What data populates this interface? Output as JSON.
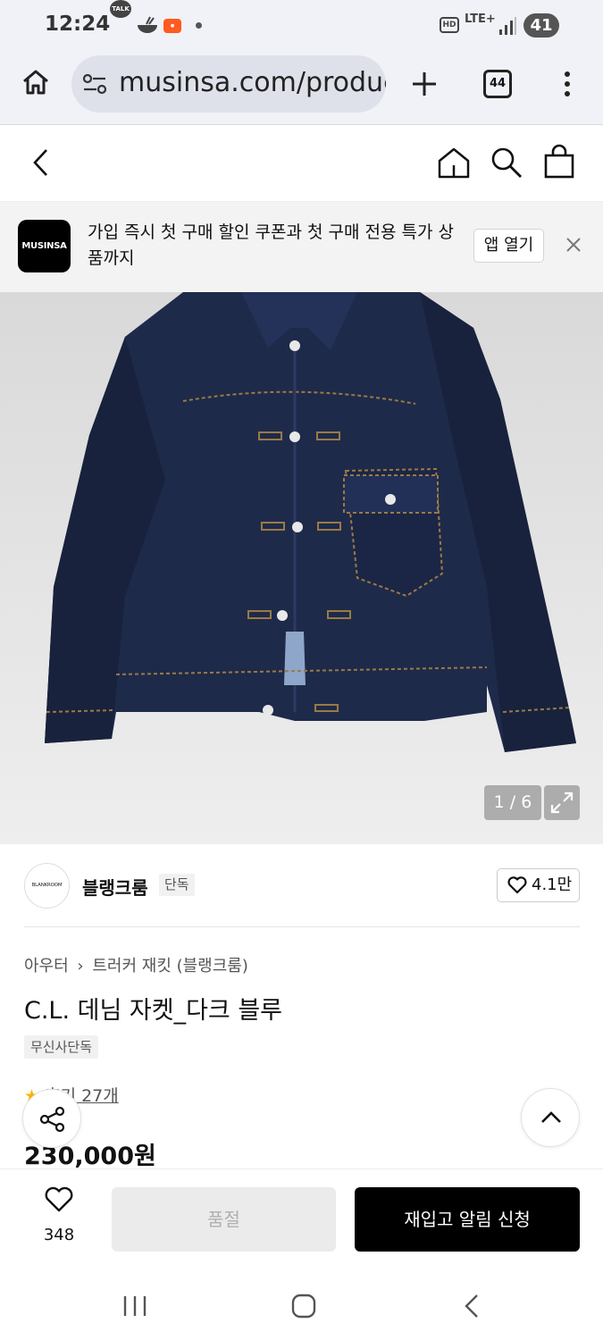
{
  "status_bar": {
    "time": "12:24",
    "talk_label": "TALK",
    "hd_label": "HD",
    "network_label": "LTE+",
    "battery": "41"
  },
  "browser": {
    "url": "musinsa.com/product",
    "tab_count": "44"
  },
  "banner": {
    "logo_text": "MUSINSA",
    "message": "가입 즉시 첫 구매 할인 쿠폰과 첫 구매 전용 특가 상품까지",
    "open_app_label": "앱 열기"
  },
  "gallery": {
    "counter": "1 / 6"
  },
  "brand": {
    "logo_text": "BLANKROOM",
    "name": "블랭크룸",
    "exclusive_tag": "단독",
    "like_count": "4.1만"
  },
  "product": {
    "breadcrumb_category": "아우터",
    "breadcrumb_sub": "트러커 재킷 (블랭크룸)",
    "title": "C.L. 데님 자켓_다크 블루",
    "badge": "무신사단독",
    "review_link": "후기 27개",
    "price": "230,000원"
  },
  "purchase_bar": {
    "wish_count": "348",
    "soldout_label": "품절",
    "restock_label": "재입고 알림 신청"
  },
  "colors": {
    "accent_star": "#ffb300",
    "primary_button": "#000000",
    "disabled_button": "#ebebeb"
  }
}
